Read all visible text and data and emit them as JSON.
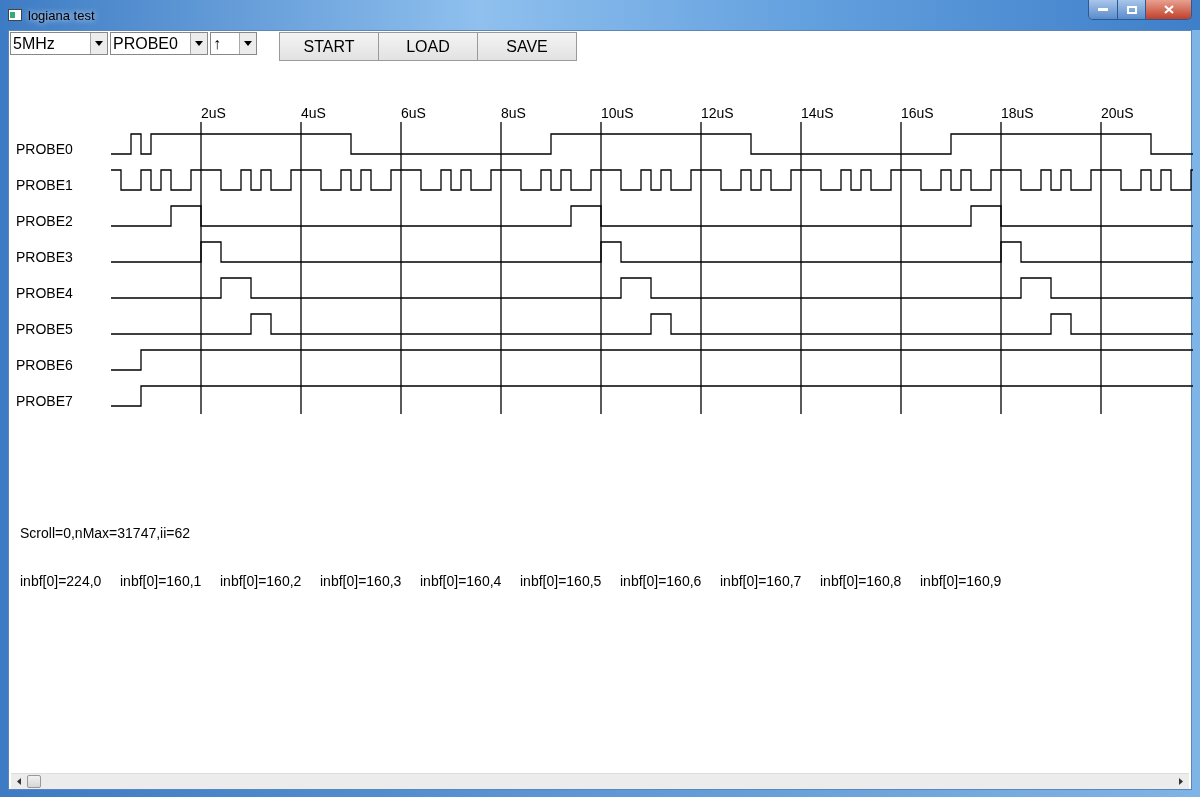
{
  "window": {
    "title": "logiana test"
  },
  "toolbar": {
    "dropdowns": [
      {
        "value": "5MHz"
      },
      {
        "value": "PROBE0"
      },
      {
        "value": "↑"
      }
    ],
    "buttons": [
      "START",
      "LOAD",
      "SAVE"
    ]
  },
  "timing_diagram": {
    "time_labels": [
      "2uS",
      "4uS",
      "6uS",
      "8uS",
      "10uS",
      "12uS",
      "14uS",
      "16uS",
      "18uS",
      "20uS"
    ],
    "probes": [
      "PROBE0",
      "PROBE1",
      "PROBE2",
      "PROBE3",
      "PROBE4",
      "PROBE5",
      "PROBE6",
      "PROBE7"
    ]
  },
  "status": "Scroll=0,nMax=31747,ii=62",
  "buffer_values": [
    "inbf[0]=224,0",
    "inbf[0]=160,1",
    "inbf[0]=160,2",
    "inbf[0]=160,3",
    "inbf[0]=160,4",
    "inbf[0]=160,5",
    "inbf[0]=160,6",
    "inbf[0]=160,7",
    "inbf[0]=160,8",
    "inbf[0]=160,9"
  ]
}
